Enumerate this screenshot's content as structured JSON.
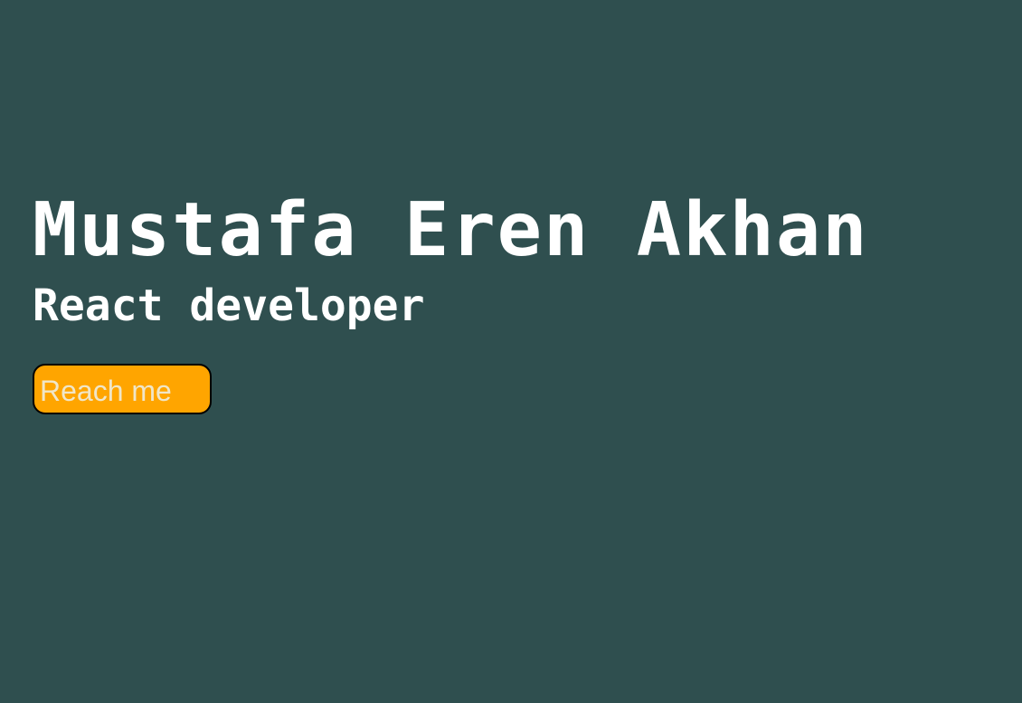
{
  "hero": {
    "name": "Mustafa Eren Akhan",
    "role": "React developer",
    "cta_label": "Reach me"
  },
  "colors": {
    "background": "#2f4f4f",
    "text": "#ffffff",
    "button_bg": "#ffa500",
    "button_text": "#f0e6c8"
  }
}
